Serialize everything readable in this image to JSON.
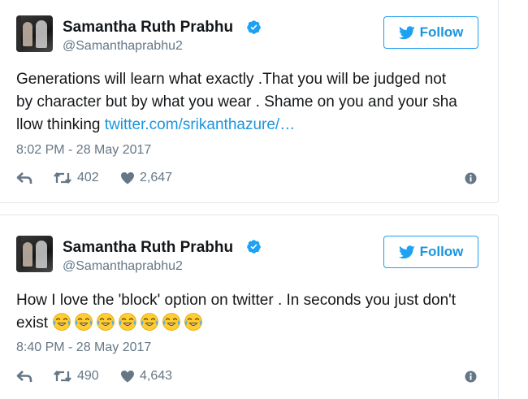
{
  "colors": {
    "link": "#1b95e0",
    "follow_border": "#1da1f2",
    "muted": "#657786",
    "verified": "#1da1f2",
    "text": "#14171a"
  },
  "tweets": [
    {
      "author_name": "Samantha Ruth Prabhu",
      "author_handle": "@Samanthaprabhu2",
      "verified_icon": "verified-badge-icon",
      "follow_label": "Follow",
      "text_lines": [
        "Generations will learn what exactly .That you will be judged not",
        "by character but by what you wear . Shame on you and your sha",
        "llow thinking "
      ],
      "link_text": "twitter.com/srikanthazure/…",
      "timestamp": "8:02 PM - 28 May 2017",
      "retweets": "402",
      "likes": "2,647"
    },
    {
      "author_name": "Samantha Ruth Prabhu",
      "author_handle": "@Samanthaprabhu2",
      "verified_icon": "verified-badge-icon",
      "follow_label": "Follow",
      "text_lines": [
        "How I love the 'block' option on twitter . In seconds you just don't",
        "exist "
      ],
      "emoji": "face-with-tears-of-joy",
      "emoji_count": 7,
      "timestamp": "8:40 PM - 28 May 2017",
      "retweets": "490",
      "likes": "4,643"
    }
  ]
}
